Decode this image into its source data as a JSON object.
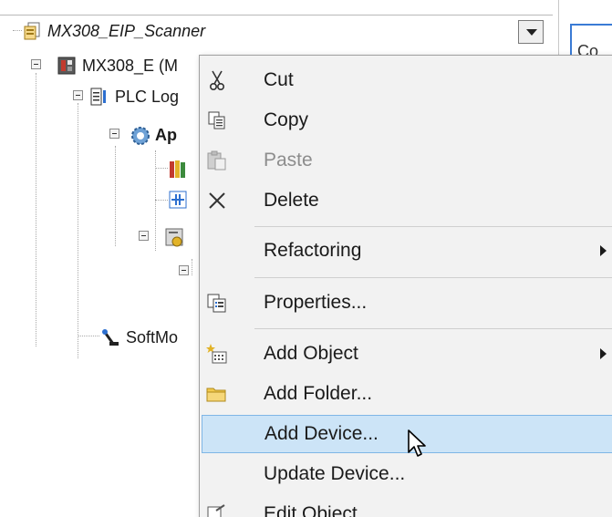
{
  "tree": {
    "nodes": [
      {
        "label": "MX308_EIP_Scanner",
        "icon": "device-copy-icon",
        "style": "italic"
      },
      {
        "label": "MX308_E (M",
        "icon": "plc-device-icon",
        "style": "normal"
      },
      {
        "label": "PLC Log",
        "icon": "plc-logic-icon",
        "style": "normal"
      },
      {
        "label": "Ap",
        "icon": "application-gear-icon",
        "style": "bold"
      },
      {
        "label": "",
        "icon": "library-books-icon",
        "style": "normal"
      },
      {
        "label": "",
        "icon": "task-config-icon",
        "style": "normal"
      },
      {
        "label": "",
        "icon": "io-mapping-icon",
        "style": "normal"
      },
      {
        "label": "SoftMo",
        "icon": "softmotion-icon",
        "style": "normal"
      }
    ]
  },
  "right_pane": {
    "tab_label": "Co"
  },
  "context_menu": {
    "items": [
      {
        "label": "Cut",
        "icon": "scissors-icon",
        "enabled": true,
        "submenu": false,
        "highlighted": false
      },
      {
        "label": "Copy",
        "icon": "copy-icon",
        "enabled": true,
        "submenu": false,
        "highlighted": false
      },
      {
        "label": "Paste",
        "icon": "paste-icon",
        "enabled": false,
        "submenu": false,
        "highlighted": false
      },
      {
        "label": "Delete",
        "icon": "delete-x-icon",
        "enabled": true,
        "submenu": false,
        "highlighted": false
      },
      {
        "label": "Refactoring",
        "icon": "",
        "enabled": true,
        "submenu": true,
        "highlighted": false
      },
      {
        "label": "Properties...",
        "icon": "properties-icon",
        "enabled": true,
        "submenu": false,
        "highlighted": false
      },
      {
        "label": "Add Object",
        "icon": "add-object-icon",
        "enabled": true,
        "submenu": true,
        "highlighted": false
      },
      {
        "label": "Add Folder...",
        "icon": "folder-icon",
        "enabled": true,
        "submenu": false,
        "highlighted": false
      },
      {
        "label": "Add Device...",
        "icon": "",
        "enabled": true,
        "submenu": false,
        "highlighted": true
      },
      {
        "label": "Update Device...",
        "icon": "",
        "enabled": true,
        "submenu": false,
        "highlighted": false
      },
      {
        "label": "Edit Object",
        "icon": "edit-object-icon",
        "enabled": true,
        "submenu": false,
        "highlighted": false
      }
    ],
    "highlight_color": "#cce4f7",
    "highlight_border": "#7fb6e6"
  }
}
